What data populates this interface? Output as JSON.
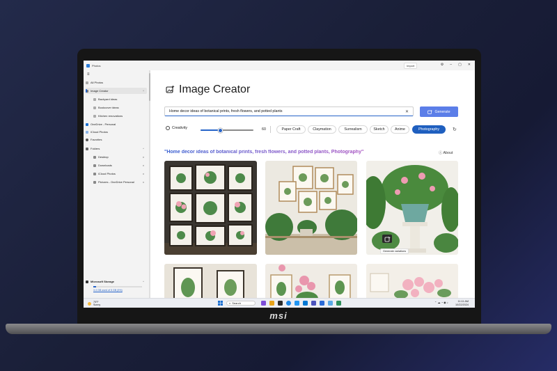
{
  "window": {
    "title": "Photos",
    "import_label": "Import"
  },
  "sidebar": {
    "items": [
      {
        "label": "All Photos",
        "icon": "photos-icon"
      },
      {
        "label": "Image Creator",
        "icon": "image-creator-icon",
        "selected": true
      },
      {
        "label": "Backyard ideas",
        "icon": "collection-icon"
      },
      {
        "label": "Bookcover ideas",
        "icon": "collection-icon"
      },
      {
        "label": "Kitchen renovations",
        "icon": "collection-icon"
      },
      {
        "label": "OneDrive - Personal",
        "icon": "onedrive-icon"
      },
      {
        "label": "iCloud Photos",
        "icon": "icloud-icon"
      },
      {
        "label": "Favorites",
        "icon": "heart-icon"
      },
      {
        "label": "Folders",
        "icon": "folder-icon"
      },
      {
        "label": "Desktop",
        "icon": "folder-icon"
      },
      {
        "label": "Downloads",
        "icon": "folder-icon"
      },
      {
        "label": "iCloud Photos",
        "icon": "folder-icon"
      },
      {
        "label": "Pictures - OneDrive Personal",
        "icon": "folder-icon"
      }
    ],
    "storage": {
      "title": "Microsoft Storage",
      "detail": "3.3 GB used of 5 GB (5%)",
      "fraction": 0.05
    }
  },
  "creator": {
    "title": "Image Creator",
    "prompt": "Home decor ideas of botanical prints, fresh flowers, and potted plants",
    "generate_label": "Generate",
    "creativity_label": "Creativity",
    "creativity_value": "60",
    "creativity_fraction": 0.37,
    "styles": [
      "Paper Craft",
      "Claymation",
      "Surrealism",
      "Sketch",
      "Anime",
      "Photography"
    ],
    "active_style": "Photography",
    "result_heading": "\"Home decor ideas of botanical prints, fresh flowers, and potted plants, Photography\"",
    "about_label": "About",
    "tooltip": "Generate variations"
  },
  "taskbar": {
    "weather_temp": "75°F",
    "weather_desc": "Sunny",
    "search_placeholder": "Search",
    "time": "11:11 AM",
    "date": "10/22/2024"
  },
  "colors": {
    "accent": "#2563c9",
    "generate": "#5b7ee8",
    "heading_start": "#2f5bd0",
    "heading_end": "#a54fc0"
  }
}
